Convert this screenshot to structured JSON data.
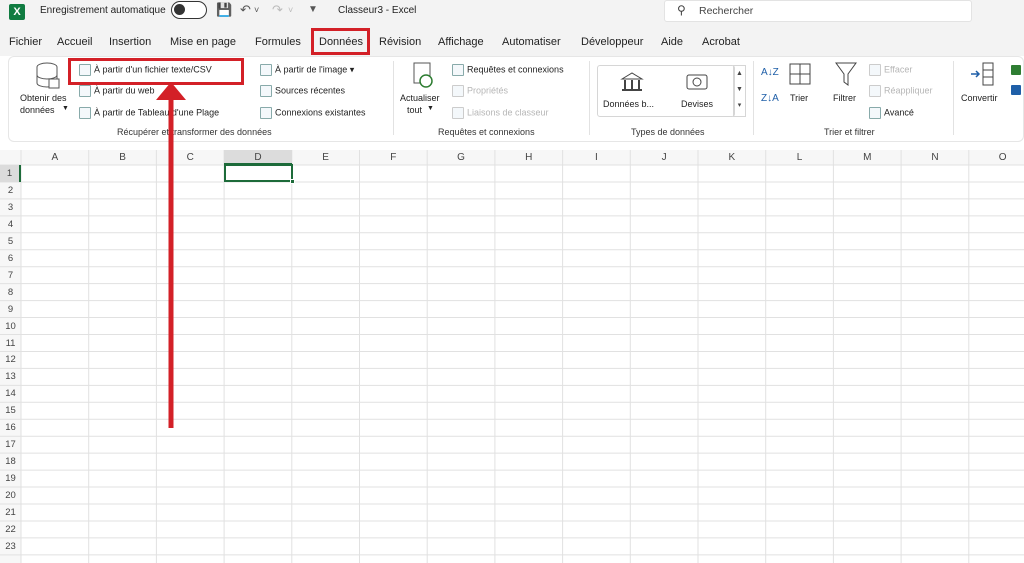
{
  "titlebar": {
    "autosave_label": "Enregistrement automatique",
    "doc_title": "Classeur3 - Excel",
    "search_placeholder": "Rechercher"
  },
  "tabs": [
    "Fichier",
    "Accueil",
    "Insertion",
    "Mise en page",
    "Formules",
    "Données",
    "Révision",
    "Affichage",
    "Automatiser",
    "Développeur",
    "Aide",
    "Acrobat"
  ],
  "active_tab": "Données",
  "ribbon": {
    "get_data": {
      "line1": "Obtenir des",
      "line2": "données"
    },
    "from_text_csv": "À partir d'un fichier texte/CSV",
    "from_web": "À partir du web",
    "from_table": "À partir de Tableau d'une Plage",
    "from_image": "À partir de l'image",
    "recent_sources": "Sources récentes",
    "existing_connections": "Connexions existantes",
    "group_get_transform": "Récupérer et transformer des données",
    "refresh": {
      "line1": "Actualiser",
      "line2": "tout"
    },
    "queries_connections": "Requêtes et connexions",
    "properties": "Propriétés",
    "workbook_links": "Liaisons de classeur",
    "group_queries": "Requêtes et connexions",
    "stocks": "Données b...",
    "currencies": "Devises",
    "group_data_types": "Types de données",
    "sort": "Trier",
    "filter": "Filtrer",
    "clear": "Effacer",
    "reapply": "Réappliquer",
    "advanced": "Avancé",
    "group_sort_filter": "Trier et filtrer",
    "convert": "Convertir"
  },
  "sheet": {
    "columns": [
      "A",
      "B",
      "C",
      "D",
      "E",
      "F",
      "G",
      "H",
      "I",
      "J",
      "K",
      "L",
      "M",
      "N",
      "O"
    ],
    "rows": [
      "1",
      "2",
      "3",
      "4",
      "5",
      "6",
      "7",
      "8",
      "9",
      "10",
      "11",
      "12",
      "13",
      "14",
      "15",
      "16",
      "17",
      "18",
      "19",
      "20",
      "21",
      "22",
      "23"
    ],
    "selected_cell": "D1"
  },
  "colors": {
    "highlight_red": "#d32027",
    "excel_green": "#107c41",
    "grid_line": "#e1e1e1"
  }
}
